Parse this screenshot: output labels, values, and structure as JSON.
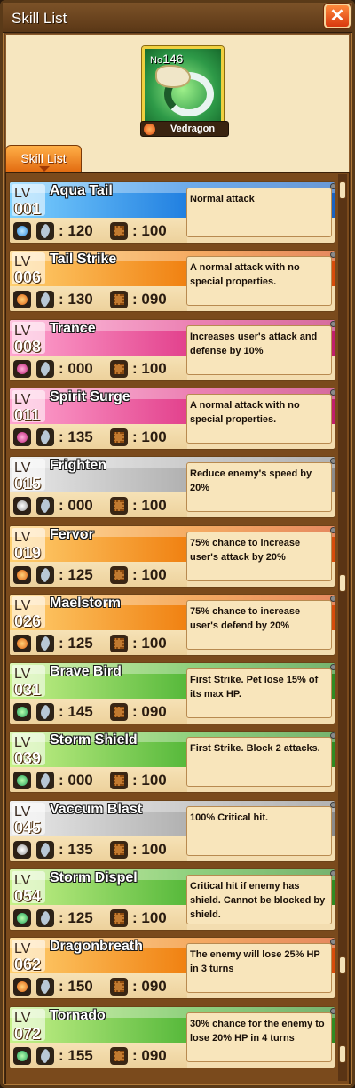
{
  "window": {
    "title": "Skill List"
  },
  "pet": {
    "number_prefix": "No",
    "number": "146",
    "name": "Vedragon"
  },
  "tab": {
    "label": "Skill List"
  },
  "colors": {
    "water": "#2f8fe8",
    "fire": "#ef7a10",
    "mystic": "#e0408a",
    "normal": "#a8a8a8",
    "wind": "#4fb83a"
  },
  "skills": [
    {
      "lv_label": "LV",
      "level": "001",
      "name": "Aqua Tail",
      "element": "water",
      "power": ": 120",
      "pp": ": 100",
      "description": "Normal attack"
    },
    {
      "lv_label": "LV",
      "level": "006",
      "name": "Tail Strike",
      "element": "fire",
      "power": ": 130",
      "pp": ": 090",
      "description": "A normal attack with no special properties."
    },
    {
      "lv_label": "LV",
      "level": "008",
      "name": "Trance",
      "element": "mystic",
      "power": ": 000",
      "pp": ": 100",
      "description": "Increases user's attack and defense by 10%"
    },
    {
      "lv_label": "LV",
      "level": "011",
      "name": "Spirit Surge",
      "element": "mystic",
      "power": ": 135",
      "pp": ": 100",
      "description": "A normal attack with no special properties."
    },
    {
      "lv_label": "LV",
      "level": "015",
      "name": "Frighten",
      "element": "normal",
      "power": ": 000",
      "pp": ": 100",
      "description": "Reduce enemy's speed by 20%"
    },
    {
      "lv_label": "LV",
      "level": "019",
      "name": "Fervor",
      "element": "fire",
      "power": ": 125",
      "pp": ": 100",
      "description": "75% chance to increase user's attack by 20%"
    },
    {
      "lv_label": "LV",
      "level": "026",
      "name": "Maelstorm",
      "element": "fire",
      "power": ": 125",
      "pp": ": 100",
      "description": "75% chance to increase user's defend by 20%"
    },
    {
      "lv_label": "LV",
      "level": "031",
      "name": "Brave Bird",
      "element": "wind",
      "power": ": 145",
      "pp": ": 090",
      "description": "First Strike. Pet lose 15% of its max HP."
    },
    {
      "lv_label": "LV",
      "level": "039",
      "name": "Storm Shield",
      "element": "wind",
      "power": ": 000",
      "pp": ": 100",
      "description": "First Strike. Block 2 attacks."
    },
    {
      "lv_label": "LV",
      "level": "045",
      "name": "Vaccum Blast",
      "element": "normal",
      "power": ": 135",
      "pp": ": 100",
      "description": "100% Critical hit."
    },
    {
      "lv_label": "LV",
      "level": "054",
      "name": "Storm Dispel",
      "element": "wind",
      "power": ": 125",
      "pp": ": 100",
      "description": "Critical hit if enemy has shield. Cannot be blocked by shield."
    },
    {
      "lv_label": "LV",
      "level": "062",
      "name": "Dragonbreath",
      "element": "fire",
      "power": ": 150",
      "pp": ": 090",
      "description": "The enemy will lose 25% HP in 3 turns"
    },
    {
      "lv_label": "LV",
      "level": "072",
      "name": "Tornado",
      "element": "wind",
      "power": ": 155",
      "pp": ": 090",
      "description": "30% chance for the enemy to lose 20% HP in 4 turns"
    }
  ]
}
